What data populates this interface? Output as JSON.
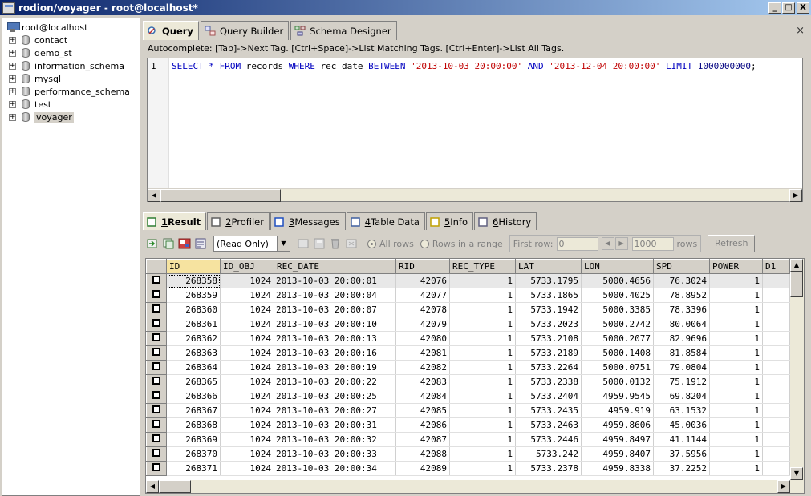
{
  "window": {
    "title": "rodion/voyager - root@localhost*",
    "minimize": "_",
    "maximize": "□",
    "close": "X"
  },
  "tree": {
    "root": "root@localhost",
    "databases": [
      "contact",
      "demo_st",
      "information_schema",
      "mysql",
      "performance_schema",
      "test",
      "voyager"
    ],
    "selected": "voyager"
  },
  "tabs": {
    "query": "Query",
    "builder": "Query Builder",
    "designer": "Schema Designer",
    "close": "×"
  },
  "autocomplete": "Autocomplete: [Tab]->Next Tag. [Ctrl+Space]->List Matching Tags. [Ctrl+Enter]->List All Tags.",
  "editor": {
    "line_number": "1",
    "tokens": [
      {
        "t": "SELECT",
        "c": "kw"
      },
      {
        "t": " ",
        "c": ""
      },
      {
        "t": "*",
        "c": "kw"
      },
      {
        "t": " ",
        "c": ""
      },
      {
        "t": "FROM",
        "c": "kw"
      },
      {
        "t": " records ",
        "c": ""
      },
      {
        "t": "WHERE",
        "c": "kw"
      },
      {
        "t": " rec_date ",
        "c": ""
      },
      {
        "t": "BETWEEN",
        "c": "kw"
      },
      {
        "t": " ",
        "c": ""
      },
      {
        "t": "'2013-10-03 20:00:00'",
        "c": "str"
      },
      {
        "t": " ",
        "c": ""
      },
      {
        "t": "AND",
        "c": "kw"
      },
      {
        "t": " ",
        "c": ""
      },
      {
        "t": "'2013-12-04 20:00:00'",
        "c": "str"
      },
      {
        "t": " ",
        "c": ""
      },
      {
        "t": "LIMIT",
        "c": "kw"
      },
      {
        "t": " ",
        "c": ""
      },
      {
        "t": "1000000000",
        "c": "num"
      },
      {
        "t": ";",
        "c": ""
      }
    ]
  },
  "result_tabs": [
    {
      "num": "1",
      "label": "Result"
    },
    {
      "num": "2",
      "label": "Profiler"
    },
    {
      "num": "3",
      "label": "Messages"
    },
    {
      "num": "4",
      "label": "Table Data"
    },
    {
      "num": "5",
      "label": "Info"
    },
    {
      "num": "6",
      "label": "History"
    }
  ],
  "toolbar": {
    "mode": "(Read Only)",
    "all_rows": "All rows",
    "rows_range": "Rows in a range",
    "first_row_label": "First row:",
    "first_row_value": "0",
    "rows_value": "1000",
    "rows_label": "rows",
    "refresh": "Refresh"
  },
  "grid": {
    "columns": [
      "ID",
      "ID_OBJ",
      "REC_DATE",
      "RID",
      "REC_TYPE",
      "LAT",
      "LON",
      "SPD",
      "POWER",
      "D1"
    ],
    "rows": [
      [
        "268358",
        "1024",
        "2013-10-03  20:00:01",
        "42076",
        "1",
        "5733.1795",
        "5000.4656",
        "76.3024",
        "1",
        ""
      ],
      [
        "268359",
        "1024",
        "2013-10-03  20:00:04",
        "42077",
        "1",
        "5733.1865",
        "5000.4025",
        "78.8952",
        "1",
        ""
      ],
      [
        "268360",
        "1024",
        "2013-10-03  20:00:07",
        "42078",
        "1",
        "5733.1942",
        "5000.3385",
        "78.3396",
        "1",
        ""
      ],
      [
        "268361",
        "1024",
        "2013-10-03  20:00:10",
        "42079",
        "1",
        "5733.2023",
        "5000.2742",
        "80.0064",
        "1",
        ""
      ],
      [
        "268362",
        "1024",
        "2013-10-03  20:00:13",
        "42080",
        "1",
        "5733.2108",
        "5000.2077",
        "82.9696",
        "1",
        ""
      ],
      [
        "268363",
        "1024",
        "2013-10-03  20:00:16",
        "42081",
        "1",
        "5733.2189",
        "5000.1408",
        "81.8584",
        "1",
        ""
      ],
      [
        "268364",
        "1024",
        "2013-10-03  20:00:19",
        "42082",
        "1",
        "5733.2264",
        "5000.0751",
        "79.0804",
        "1",
        ""
      ],
      [
        "268365",
        "1024",
        "2013-10-03  20:00:22",
        "42083",
        "1",
        "5733.2338",
        "5000.0132",
        "75.1912",
        "1",
        ""
      ],
      [
        "268366",
        "1024",
        "2013-10-03  20:00:25",
        "42084",
        "1",
        "5733.2404",
        "4959.9545",
        "69.8204",
        "1",
        ""
      ],
      [
        "268367",
        "1024",
        "2013-10-03  20:00:27",
        "42085",
        "1",
        "5733.2435",
        "4959.919",
        "63.1532",
        "1",
        ""
      ],
      [
        "268368",
        "1024",
        "2013-10-03  20:00:31",
        "42086",
        "1",
        "5733.2463",
        "4959.8606",
        "45.0036",
        "1",
        ""
      ],
      [
        "268369",
        "1024",
        "2013-10-03  20:00:32",
        "42087",
        "1",
        "5733.2446",
        "4959.8497",
        "41.1144",
        "1",
        ""
      ],
      [
        "268370",
        "1024",
        "2013-10-03  20:00:33",
        "42088",
        "1",
        "5733.242",
        "4959.8407",
        "37.5956",
        "1",
        ""
      ],
      [
        "268371",
        "1024",
        "2013-10-03  20:00:34",
        "42089",
        "1",
        "5733.2378",
        "4959.8338",
        "37.2252",
        "1",
        ""
      ]
    ]
  }
}
